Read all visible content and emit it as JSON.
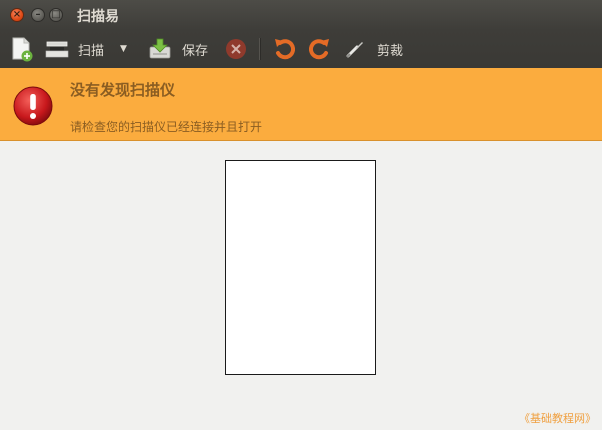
{
  "window": {
    "title": "扫描易"
  },
  "toolbar": {
    "scan_label": "扫描",
    "save_label": "保存",
    "crop_label": "剪裁"
  },
  "infobar": {
    "title": "没有发现扫描仪",
    "description": "请检查您的扫描仪已经连接并且打开",
    "background_color": "#fbac3e"
  },
  "watermark": {
    "text": "《基础教程网》"
  },
  "icons": {
    "new_document": "new-document-icon",
    "scanner": "scanner-icon",
    "dropdown": "dropdown-arrow-icon",
    "save": "save-icon",
    "stop": "stop-icon",
    "rotate_left": "rotate-left-icon",
    "rotate_right": "rotate-right-icon",
    "crop": "crop-icon",
    "alert": "alert-icon"
  }
}
